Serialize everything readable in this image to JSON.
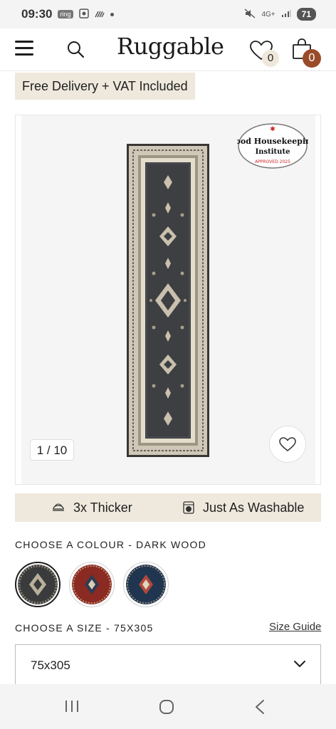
{
  "status_bar": {
    "time": "09:30",
    "ring_label": "ring",
    "network": "4G+",
    "battery": "71"
  },
  "header": {
    "logo": "Ruggable",
    "wishlist_count": "0",
    "cart_count": "0"
  },
  "promo": {
    "text": "Free Delivery + VAT Included"
  },
  "gallery": {
    "counter": "1 / 10",
    "badge": {
      "line1": "Good Housekeeping",
      "line2": "Institute",
      "line3": "APPROVED 2025"
    }
  },
  "features": [
    {
      "label": "3x Thicker",
      "icon": "thick-layers-icon"
    },
    {
      "label": "Just As Washable",
      "icon": "washing-machine-icon"
    }
  ],
  "colour": {
    "label": "CHOOSE A COLOUR - DARK WOOD",
    "swatches": [
      {
        "name": "dark-wood",
        "color": "#3a3b3c",
        "selected": true
      },
      {
        "name": "red",
        "color": "#8a2a22",
        "selected": false
      },
      {
        "name": "navy",
        "color": "#1f3550",
        "selected": false
      }
    ]
  },
  "size": {
    "label": "CHOOSE A SIZE - 75X305",
    "guide": "Size Guide",
    "selected": "75x305"
  },
  "colors": {
    "promo_bg": "#efe9dd",
    "cart_badge": "#9a4c2a",
    "wish_badge": "#efe7d9"
  }
}
